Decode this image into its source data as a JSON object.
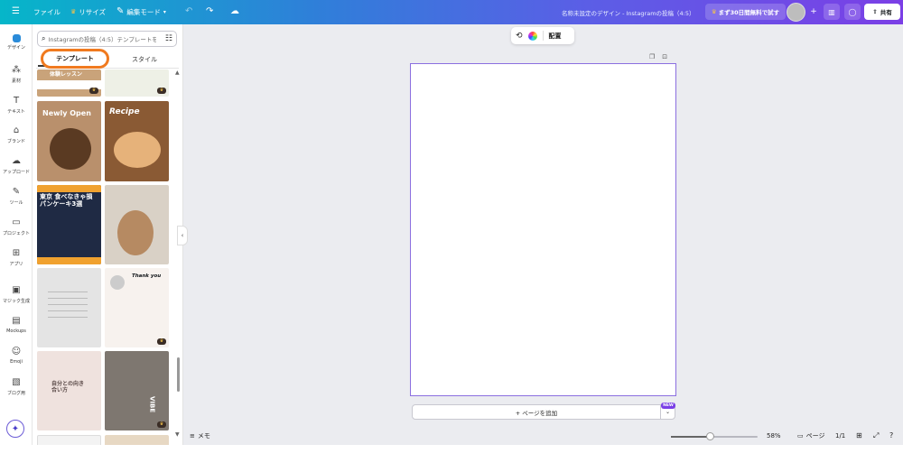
{
  "topbar": {
    "file_label": "ファイル",
    "resize_label": "リサイズ",
    "edit_mode_label": "編集モード",
    "doc_title": "名称未設定のデザイン - Instagramの投稿（4:5）",
    "trial_label": "まず30日間無料で試す",
    "share_label": "共有"
  },
  "rail": {
    "items": [
      {
        "label": "デザイン",
        "icon": "design-icon"
      },
      {
        "label": "素材",
        "icon": "elements-icon"
      },
      {
        "label": "テキスト",
        "icon": "text-icon"
      },
      {
        "label": "ブランド",
        "icon": "brand-icon"
      },
      {
        "label": "アップロード",
        "icon": "upload-icon"
      },
      {
        "label": "ツール",
        "icon": "tools-icon"
      },
      {
        "label": "プロジェクト",
        "icon": "folder-icon"
      },
      {
        "label": "アプリ",
        "icon": "apps-icon"
      },
      {
        "label": "マジック生成",
        "icon": "magic-icon"
      },
      {
        "label": "Mockups",
        "icon": "mockups-icon"
      },
      {
        "label": "Emoji",
        "icon": "emoji-icon"
      },
      {
        "label": "ブログ用",
        "icon": "blog-icon"
      }
    ]
  },
  "panel": {
    "search_placeholder": "Instagramの投稿（4:5）テンプレートを",
    "tab_template": "テンプレート",
    "tab_style": "スタイル",
    "thumbs": [
      {
        "text": "体験レッスン",
        "bg": "#c9a37a"
      },
      {
        "text": "",
        "bg": "#eef0e6"
      },
      {
        "text": "Newly Open",
        "bg": "#b9906c"
      },
      {
        "text": "Recipe",
        "bg": "#8a5a34"
      },
      {
        "text": "東京 食べなきゃ損 パンケーキ3選",
        "bg": "#f0a12f"
      },
      {
        "text": "",
        "bg": "#d9d1c6"
      },
      {
        "text": "",
        "bg": "#e4e4e4"
      },
      {
        "text": "Thank you",
        "bg": "#f7f2ee"
      },
      {
        "text": "自分との向き合い方",
        "bg": "#efe2de"
      },
      {
        "text": "VIBE",
        "bg": "#7e7770"
      },
      {
        "text": "",
        "bg": "#f3f3f3"
      },
      {
        "text": "",
        "bg": "#e7d8c3"
      }
    ]
  },
  "floatbar": {
    "arrange_label": "配置"
  },
  "canvas": {
    "add_page_label": "+ ページを追加",
    "new_badge": "NEW"
  },
  "bottombar": {
    "memo_label": "メモ",
    "zoom_value": "58%",
    "zoom_fraction": 0.45,
    "pages_label": "ページ",
    "page_count": "1/1"
  }
}
